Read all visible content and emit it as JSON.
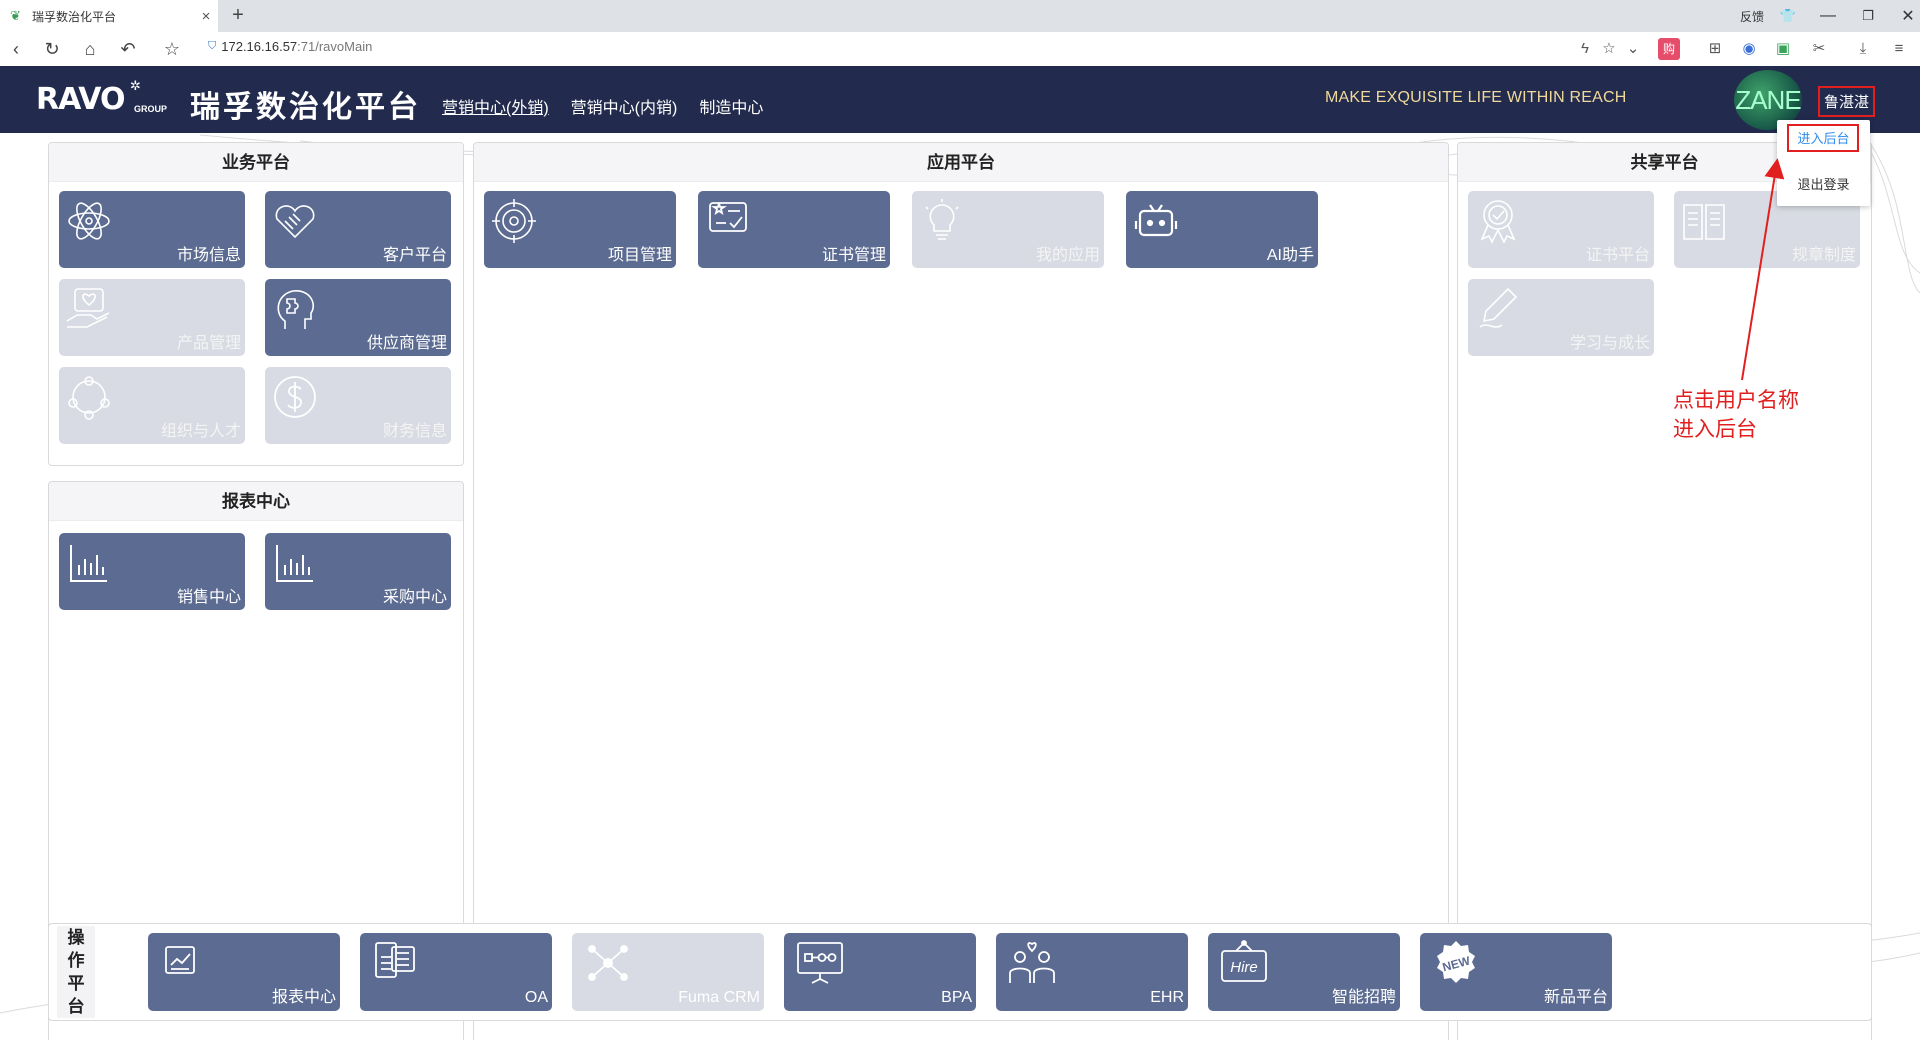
{
  "browser": {
    "tab_title": "瑞孚数治化平台",
    "tab_close": "×",
    "new_tab": "+",
    "url_host": "172.16.16.57",
    "url_path": ":71/ravoMain",
    "feedback": "反馈"
  },
  "header": {
    "logo": "RAVO",
    "logo_sub": "GROUP",
    "brand": "瑞孚数治化平台",
    "nav": [
      "营销中心(外销)",
      "营销中心(内销)",
      "制造中心"
    ],
    "slogan": "MAKE EXQUISITE LIFE WITHIN REACH",
    "avatar_text": "ZANE",
    "username": "鲁湛湛"
  },
  "dropdown": {
    "enter_admin": "进入后台",
    "logout": "退出登录"
  },
  "panels": {
    "business": {
      "title": "业务平台",
      "tiles": [
        {
          "label": "市场信息",
          "icon": "atom-icon",
          "enabled": true
        },
        {
          "label": "客户平台",
          "icon": "handshake-icon",
          "enabled": true
        },
        {
          "label": "产品管理",
          "icon": "hand-heart-icon",
          "enabled": false
        },
        {
          "label": "供应商管理",
          "icon": "puzzle-head-icon",
          "enabled": true
        },
        {
          "label": "组织与人才",
          "icon": "people-circle-icon",
          "enabled": false
        },
        {
          "label": "财务信息",
          "icon": "dollar-icon",
          "enabled": false
        }
      ]
    },
    "reports": {
      "title": "报表中心",
      "tiles": [
        {
          "label": "销售中心",
          "icon": "bar-chart-icon",
          "enabled": true
        },
        {
          "label": "采购中心",
          "icon": "bar-chart-icon",
          "enabled": true
        }
      ]
    },
    "apps": {
      "title": "应用平台",
      "tiles": [
        {
          "label": "项目管理",
          "icon": "target-icon",
          "enabled": true
        },
        {
          "label": "证书管理",
          "icon": "certificate-card-icon",
          "enabled": true
        },
        {
          "label": "我的应用",
          "icon": "lightbulb-icon",
          "enabled": false
        },
        {
          "label": "AI助手",
          "icon": "robot-icon",
          "enabled": true
        }
      ]
    },
    "shared": {
      "title": "共享平台",
      "tiles": [
        {
          "label": "证书平台",
          "icon": "award-icon",
          "enabled": false
        },
        {
          "label": "规章制度",
          "icon": "book-icon",
          "enabled": false
        },
        {
          "label": "学习与成长",
          "icon": "pen-icon",
          "enabled": false
        }
      ]
    }
  },
  "operations": {
    "side_label": [
      "操",
      "作",
      "平",
      "台"
    ],
    "tiles": [
      {
        "label": "报表中心",
        "icon": "report-icon",
        "enabled": true
      },
      {
        "label": "OA",
        "icon": "id-card-icon",
        "enabled": true
      },
      {
        "label": "Fuma CRM",
        "icon": "network-icon",
        "enabled": false
      },
      {
        "label": "BPA",
        "icon": "presentation-icon",
        "enabled": true
      },
      {
        "label": "EHR",
        "icon": "people-heart-icon",
        "enabled": true
      },
      {
        "label": "智能招聘",
        "icon": "hire-sign-icon",
        "enabled": true
      },
      {
        "label": "新品平台",
        "icon": "new-badge-icon",
        "enabled": true
      }
    ]
  },
  "annotation": {
    "line1": "点击用户名称",
    "line2": "进入后台",
    "color": "#e21f1f"
  },
  "colors": {
    "header_bg": "#222b4e",
    "tile_active": "#5c6b91",
    "tile_disabled": "#d8dbe3",
    "slogan": "#f0d99a"
  }
}
